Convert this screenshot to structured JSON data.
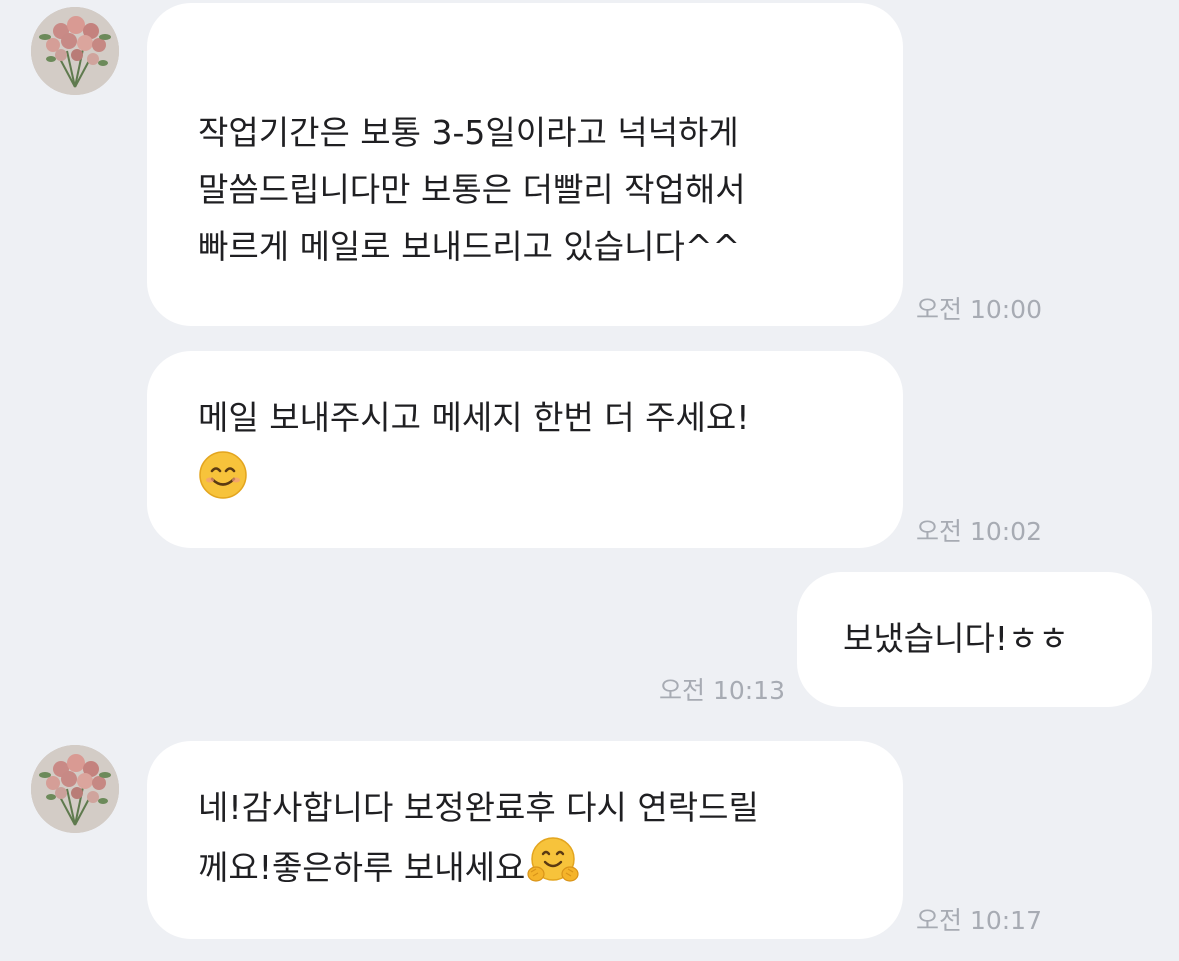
{
  "conversation": {
    "messages": [
      {
        "sender": "other",
        "text": "작업기간은 보통 3-5일이라고 넉넉하게\n말씀드립니다만 보통은 더빨리 작업해서\n빠르게 메일로 보내드리고 있습니다^^",
        "time": "오전 10:00"
      },
      {
        "sender": "other",
        "text": "메일 보내주시고 메세지 한번 더 주세요!",
        "emoji": "smiling-face-emoji",
        "time": "오전 10:02"
      },
      {
        "sender": "me",
        "text": "보냈습니다!ㅎㅎ",
        "time": "오전 10:13"
      },
      {
        "sender": "other",
        "line1": "네!감사합니다 보정완료후 다시 연락드릴",
        "line2": "께요!좋은하루 보내세요",
        "emoji": "hugging-face-emoji",
        "time": "오전 10:17"
      }
    ]
  },
  "colors": {
    "background": "#eef0f4",
    "bubble": "#ffffff",
    "text": "#1f1f22",
    "timestamp": "#a7abb3",
    "emoji_yellow": "#f7c33b"
  }
}
